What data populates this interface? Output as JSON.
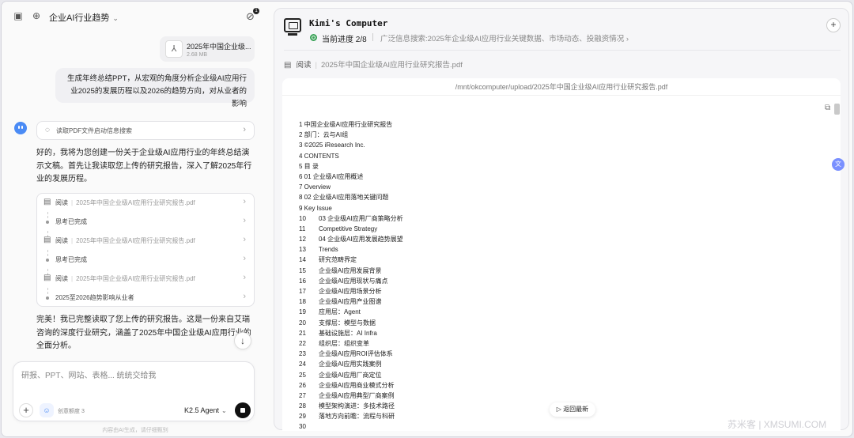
{
  "chat": {
    "title": "企业AI行业趋势",
    "attach_badge": "1",
    "file": {
      "name": "2025年中国企业级...",
      "size": "2.68 MB"
    },
    "user_message": "生成年终总结PPT，从宏观的角度分析企业级AI应用行业2025的发展历程以及2026的趋势方向，对从业者的影响",
    "search_chip": "读取PDF文件启动信息搜索",
    "bot_intro": "好的，我将为您创建一份关于企业级AI应用行业的年终总结演示文稿。首先让我读取您上传的研究报告，深入了解2025年行业的发展历程。",
    "steps": [
      {
        "type": "read",
        "label": "阅读",
        "file": "2025年中国企业级AI应用行业研究报告.pdf"
      },
      {
        "type": "done",
        "label": "思考已完成"
      },
      {
        "type": "read",
        "label": "阅读",
        "file": "2025年中国企业级AI应用行业研究报告.pdf"
      },
      {
        "type": "done",
        "label": "思考已完成"
      },
      {
        "type": "read",
        "label": "阅读",
        "file": "2025年中国企业级AI应用行业研究报告.pdf"
      },
      {
        "type": "done",
        "label": "2025至2026趋势影响从业者"
      }
    ],
    "bot_followup": "完美！我已完整读取了您上传的研究报告。这是一份来自艾瑞咨询的深度行业研究，涵盖了2025年中国企业级AI应用行业的全面分析。",
    "composer": {
      "placeholder": "研报、PPT、网站、表格... 统统交给我",
      "suggestion": "创意额度 3",
      "model": "K2.5 Agent"
    },
    "footnote": "内容由AI生成，请仔细甄别"
  },
  "computer": {
    "title": "Kimi's Computer",
    "progress_label": "当前进度 2/8",
    "task": "广泛信息搜索:2025年企业级AI应用行业关键数据、市场动态、投融资情况",
    "read_label": "阅读",
    "read_file": "2025年中国企业级AI应用行业研究报告.pdf",
    "path": "/mnt/okcomputer/upload/2025年中国企业级AI应用行业研究报告.pdf",
    "latest_button": "返回最新",
    "lines": [
      "1 中国企业级AI应用行业研究报告",
      "2 部门：云与AI组",
      "3 ©2025 iResearch Inc.",
      "4 CONTENTS",
      "5 目 录",
      "6 01 企业级AI应用概述",
      "7 Overview",
      "8 02 企业级AI应用落地关键问题",
      "9 Key Issue",
      "10|03 企业级AI应用厂商策略分析",
      "11|Competitive Strategy",
      "12|04 企业级AI应用发展趋势展望",
      "13|Trends",
      "14|研究范畴界定",
      "15|企业级AI应用发展背景",
      "16|企业级AI应用现状与痛点",
      "17|企业级AI应用场景分析",
      "18|企业级AI应用产业图谱",
      "19|应用层：Agent",
      "20|支撑层：模型与数据",
      "21|基础设施层：AI Infra",
      "22|组织层：组织变革",
      "23|企业级AI应用ROI评估体系",
      "24|企业级AI应用实践案例",
      "25|企业级AI应用厂商定位",
      "26|企业级AI应用商业模式分析",
      "27|企业级AI应用典型厂商案例",
      "28|模型架构演进：多技术路径",
      "29|落地方向前瞻：流程与科研",
      "30|"
    ]
  },
  "watermark": "苏米客 | XMSUMI.COM",
  "colors": {
    "progress": "#3aa357",
    "accent": "#4a8bf5"
  }
}
